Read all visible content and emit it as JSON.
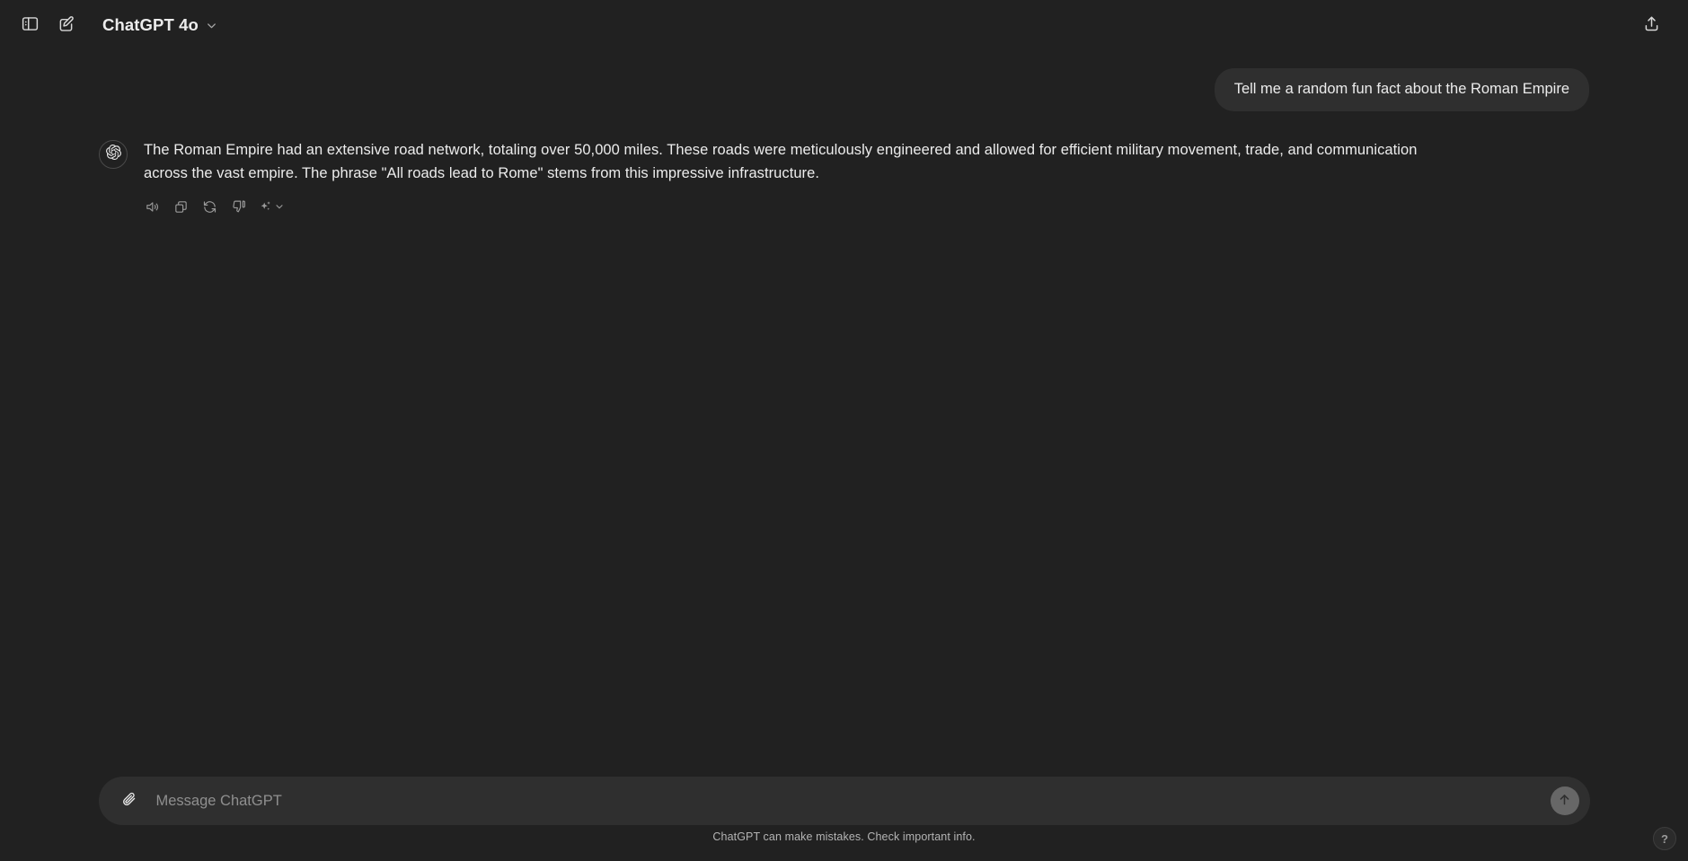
{
  "theme": {
    "background": "#212121",
    "bubble_background": "#2f2f2f",
    "text_primary": "#ececec",
    "text_muted": "#b4b4b4",
    "send_button_background": "#676767"
  },
  "topbar": {
    "sidebar_toggle_icon": "sidebar-toggle-icon",
    "new_chat_icon": "new-chat-pencil-icon",
    "model_name": "ChatGPT 4o",
    "model_chevron_icon": "chevron-down-icon",
    "share_icon": "share-upload-icon"
  },
  "conversation": {
    "messages": [
      {
        "role": "user",
        "text": "Tell me a random fun fact about the Roman Empire"
      },
      {
        "role": "assistant",
        "avatar_icon": "openai-logo-icon",
        "text": "The Roman Empire had an extensive road network, totaling over 50,000 miles. These roads were meticulously engineered and allowed for efficient military movement, trade, and communication across the vast empire. The phrase \"All roads lead to Rome\" stems from this impressive infrastructure.",
        "actions": [
          {
            "name": "read-aloud",
            "icon": "speaker-icon",
            "label": "Read aloud"
          },
          {
            "name": "copy",
            "icon": "copy-icon",
            "label": "Copy"
          },
          {
            "name": "regenerate",
            "icon": "refresh-icon",
            "label": "Regenerate"
          },
          {
            "name": "bad-response",
            "icon": "thumbs-down-icon",
            "label": "Bad response"
          },
          {
            "name": "switch-model",
            "icon": "sparkle-icon",
            "label": "Switch model"
          }
        ]
      }
    ]
  },
  "composer": {
    "attach_icon": "paperclip-icon",
    "placeholder": "Message ChatGPT",
    "value": "",
    "send_icon": "arrow-up-icon"
  },
  "footer": {
    "disclaimer": "ChatGPT can make mistakes. Check important info.",
    "help_label": "?"
  }
}
